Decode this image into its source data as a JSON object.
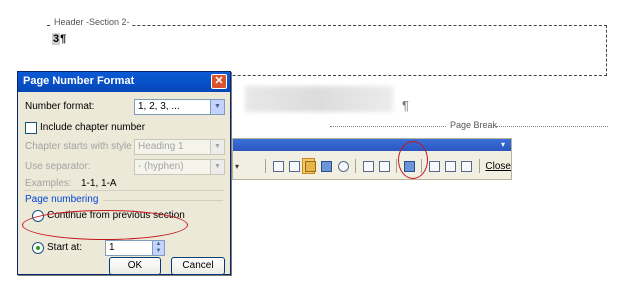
{
  "document": {
    "header_tag": "Header -Section 2-",
    "header_field": "3",
    "pilcrow": "¶",
    "page_break_label": "Page Break"
  },
  "toolbar": {
    "close_label": "Close",
    "menu_arrow": "▾"
  },
  "dialog": {
    "title": "Page Number Format",
    "close_glyph": "✕",
    "number_format_label": "Number format:",
    "number_format_value": "1, 2, 3, ...",
    "include_chapter_label": "Include chapter number",
    "chapter_style_label": "Chapter starts with style",
    "chapter_style_value": "Heading 1",
    "separator_label": "Use separator:",
    "separator_value": "-   (hyphen)",
    "examples_label": "Examples:",
    "examples_value": "1-1, 1-A",
    "page_numbering_label": "Page numbering",
    "continue_label": "Continue from previous section",
    "start_at_label": "Start at:",
    "start_at_value": "1",
    "ok_label": "OK",
    "cancel_label": "Cancel"
  },
  "colors": {
    "annotation": "#c8161d",
    "title_bar": "#0a5ad6",
    "group_title": "#0046d5"
  }
}
